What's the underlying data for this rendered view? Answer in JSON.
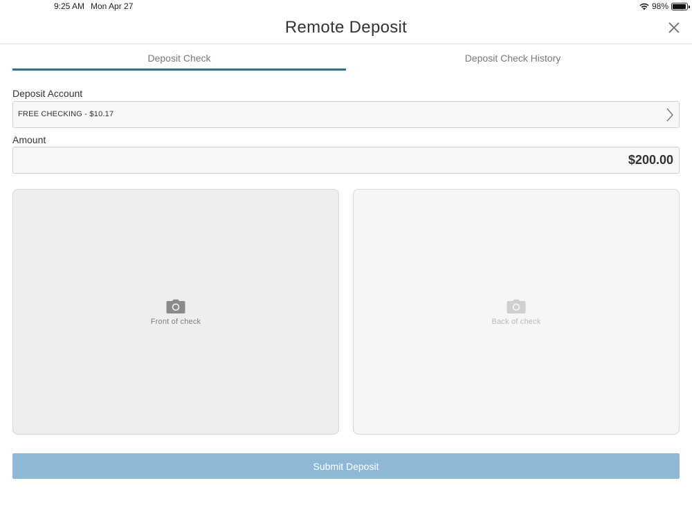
{
  "status_bar": {
    "time": "9:25 AM",
    "date": "Mon Apr 27",
    "battery": "98%",
    "icons": [
      "wifi-icon",
      "battery-icon"
    ]
  },
  "header": {
    "title": "Remote Deposit",
    "close_icon": "close-icon"
  },
  "tabs": [
    {
      "label": "Deposit Check",
      "active": true
    },
    {
      "label": "Deposit Check History",
      "active": false
    }
  ],
  "form": {
    "account_label": "Deposit Account",
    "account_value": "FREE CHECKING - $10.17",
    "amount_label": "Amount",
    "amount_value": "$200.00"
  },
  "check_capture": {
    "front_label": "Front of check",
    "back_label": "Back of check",
    "icon": "camera-icon"
  },
  "submit_label": "Submit Deposit",
  "colors": {
    "accent": "#2a6bb0",
    "submit_disabled": "#8db9d6",
    "front_panel": "#efeded",
    "back_panel": "#f6f6f6"
  }
}
